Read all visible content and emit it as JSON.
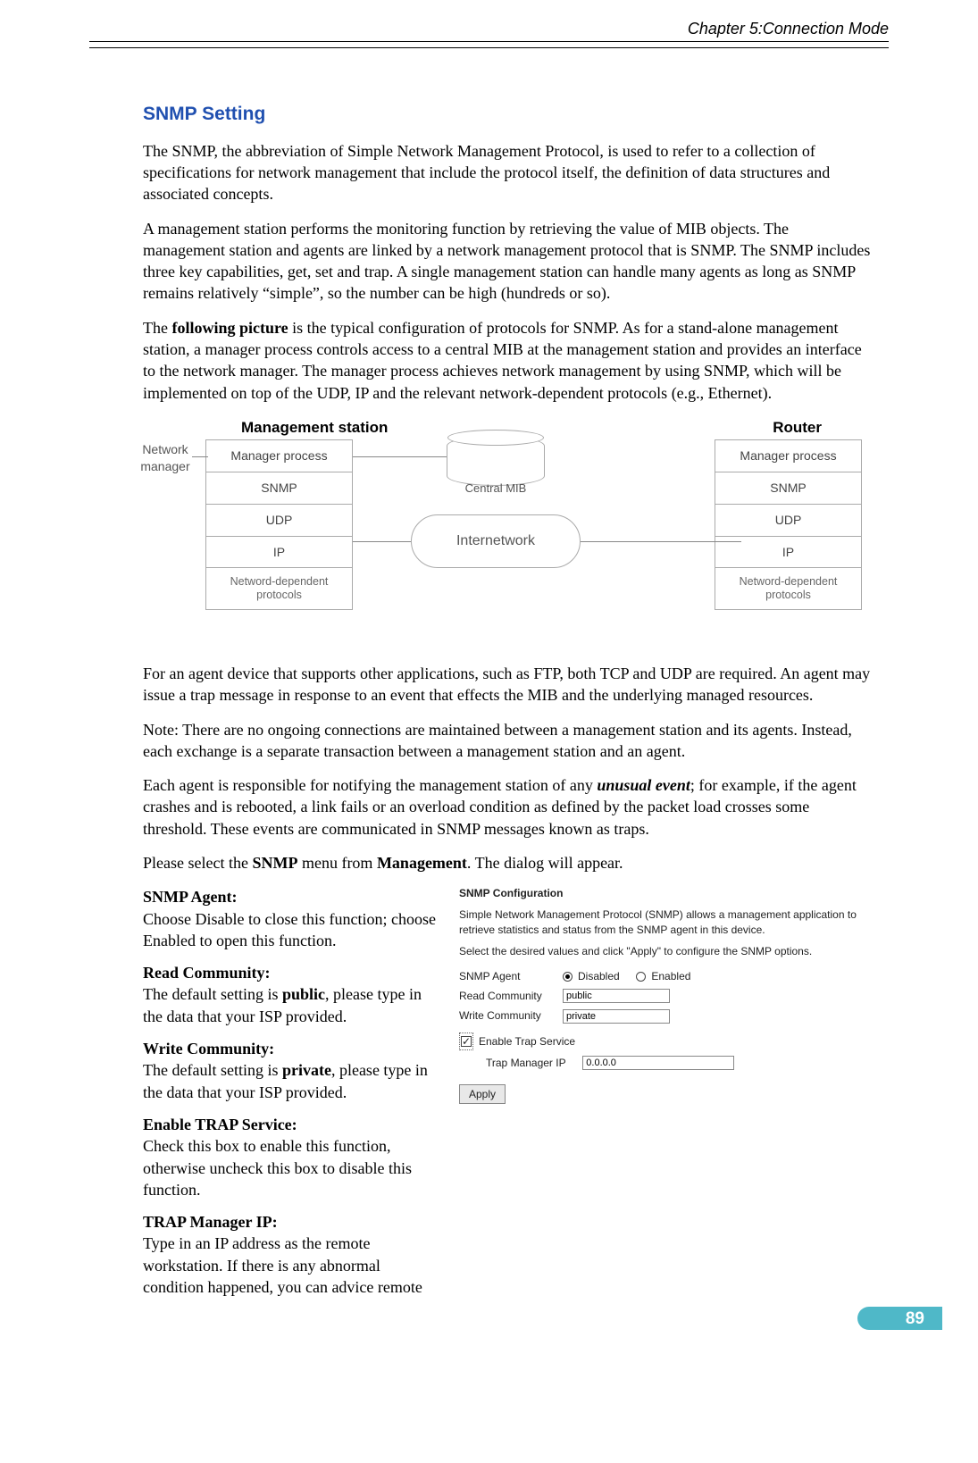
{
  "header": {
    "chapter": "Chapter 5:Connection Mode"
  },
  "section_title": "SNMP Setting",
  "paragraphs": {
    "p1": "The SNMP, the abbreviation of Simple Network Management Protocol, is used to refer to a collection of specifications for network management that include the protocol itself, the definition of data structures and associated concepts.",
    "p2": "A management station performs the monitoring function by retrieving the value of MIB objects. The management station and agents are linked by a network management protocol that is SNMP. The SNMP includes three key capabilities, get, set and trap. A single management station can handle many agents as long as SNMP remains relatively “simple”, so the number can be high (hundreds or so).",
    "p3_pre": "The ",
    "p3_bold": "following picture",
    "p3_post": " is the typical configuration of protocols for SNMP. As for a stand-alone management station, a manager process controls access to a central MIB at the management station and provides an interface to the network manager. The manager process achieves network management by using SNMP, which will be implemented on top of the UDP, IP and the relevant network-dependent protocols (e.g., Ethernet).",
    "p4": "For an agent device that supports other applications, such as FTP, both TCP and UDP are required. An agent may issue a trap message in response to an event that effects the MIB and the underlying managed resources.",
    "p5": "Note: There are no ongoing connections are maintained between a management station and its agents. Instead, each exchange is a separate transaction between a management station and an agent.",
    "p6_pre": "Each agent is responsible for notifying the management station of any ",
    "p6_bi": "unusual event",
    "p6_post": "; for example, if the agent crashes and is rebooted, a link fails or an overload condition as defined by the packet load crosses some threshold. These events are communicated in SNMP messages known as traps.",
    "p7_pre": "Please select the ",
    "p7_b1": "SNMP",
    "p7_mid": " menu from ",
    "p7_b2": "Management",
    "p7_post": ". The dialog will appear."
  },
  "diagram": {
    "title_left": "Management station",
    "title_right": "Router",
    "network_manager": "Network manager",
    "stack_cells": [
      "Manager process",
      "SNMP",
      "UDP",
      "IP",
      "Netword-dependent protocols"
    ],
    "central_mib": "Central MIB",
    "internetwork": "Internetwork"
  },
  "definitions": [
    {
      "title": "SNMP Agent:",
      "body": "Choose Disable to close this function; choose Enabled to open this function."
    },
    {
      "title": "Read Community:",
      "body_pre": "The default setting is ",
      "body_bold": "public",
      "body_post": ", please type in the data that your ISP provided."
    },
    {
      "title": "Write Community:",
      "body_pre": "The default setting is ",
      "body_bold": "private",
      "body_post": ", please type in the data that your ISP provided."
    },
    {
      "title": "Enable TRAP Service:",
      "body": "Check this box to enable this function, otherwise uncheck this box to disable this function."
    },
    {
      "title": "TRAP Manager IP:",
      "body": "Type in an IP address as the remote workstation. If there is any abnormal condition happened, you can advice remote"
    }
  ],
  "snmp_conf": {
    "heading": "SNMP Configuration",
    "desc": "Simple Network Management Protocol (SNMP) allows a management application to retrieve statistics and status from the SNMP agent in this device.",
    "instr": "Select the desired values and click \"Apply\" to configure the SNMP options.",
    "agent_label": "SNMP Agent",
    "disabled": "Disabled",
    "enabled": "Enabled",
    "read_label": "Read Community",
    "read_val": "public",
    "write_label": "Write Community",
    "write_val": "private",
    "trap_chk": "Enable Trap Service",
    "trap_ip_label": "Trap Manager IP",
    "trap_ip_val": "0.0.0.0",
    "apply": "Apply"
  },
  "page_number": "89"
}
